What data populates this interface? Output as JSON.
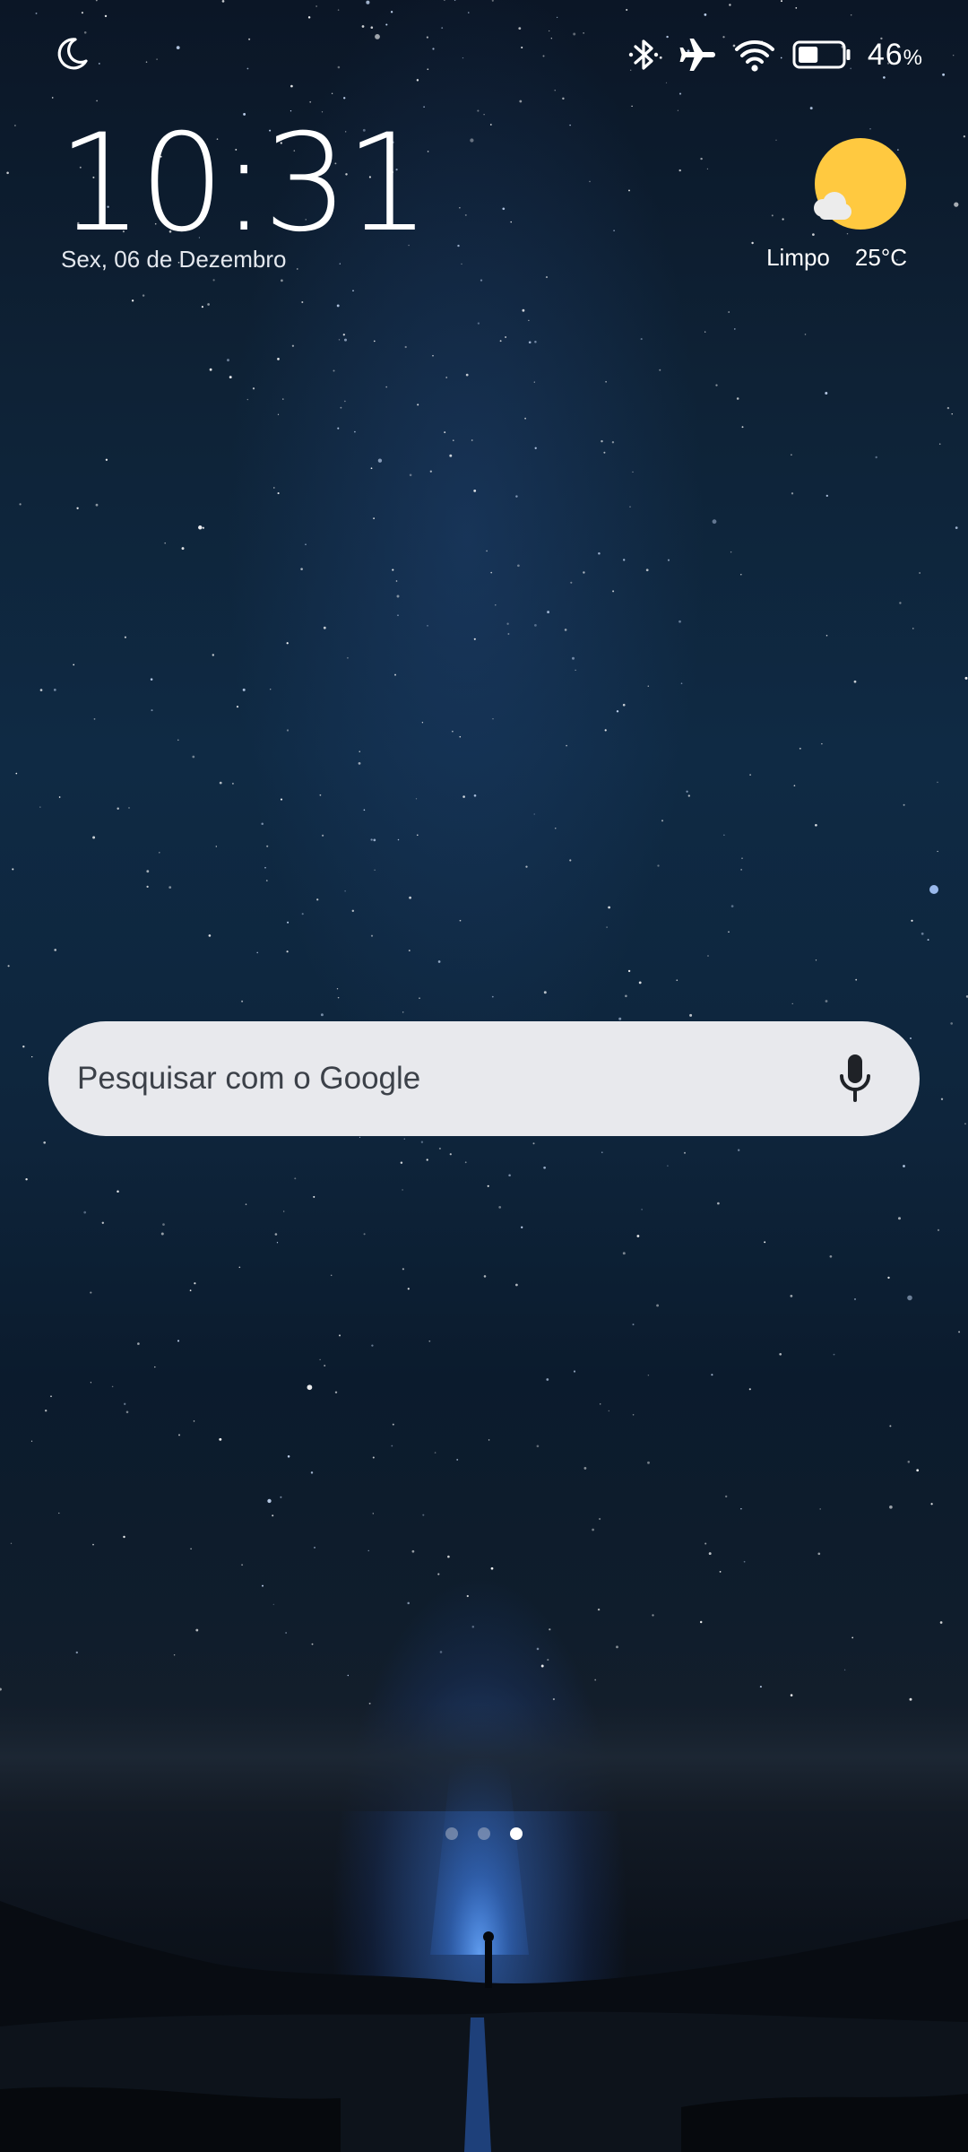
{
  "status_bar": {
    "icons": [
      "do-not-disturb-icon",
      "bluetooth-icon",
      "airplane-mode-icon",
      "wifi-icon",
      "battery-icon"
    ],
    "battery_value": "46",
    "battery_unit": "%",
    "battery_level": 0.46
  },
  "clock": {
    "time": "10:31",
    "date": "Sex, 06 de Dezembro"
  },
  "weather": {
    "icon": "sun-cloud-icon",
    "condition": "Limpo",
    "temperature": "25°C",
    "sun_color": "#FFC940"
  },
  "search": {
    "placeholder": "Pesquisar com o Google",
    "mic_icon": "microphone-icon"
  },
  "page_indicator": {
    "pages": 3,
    "active_page": 3
  }
}
